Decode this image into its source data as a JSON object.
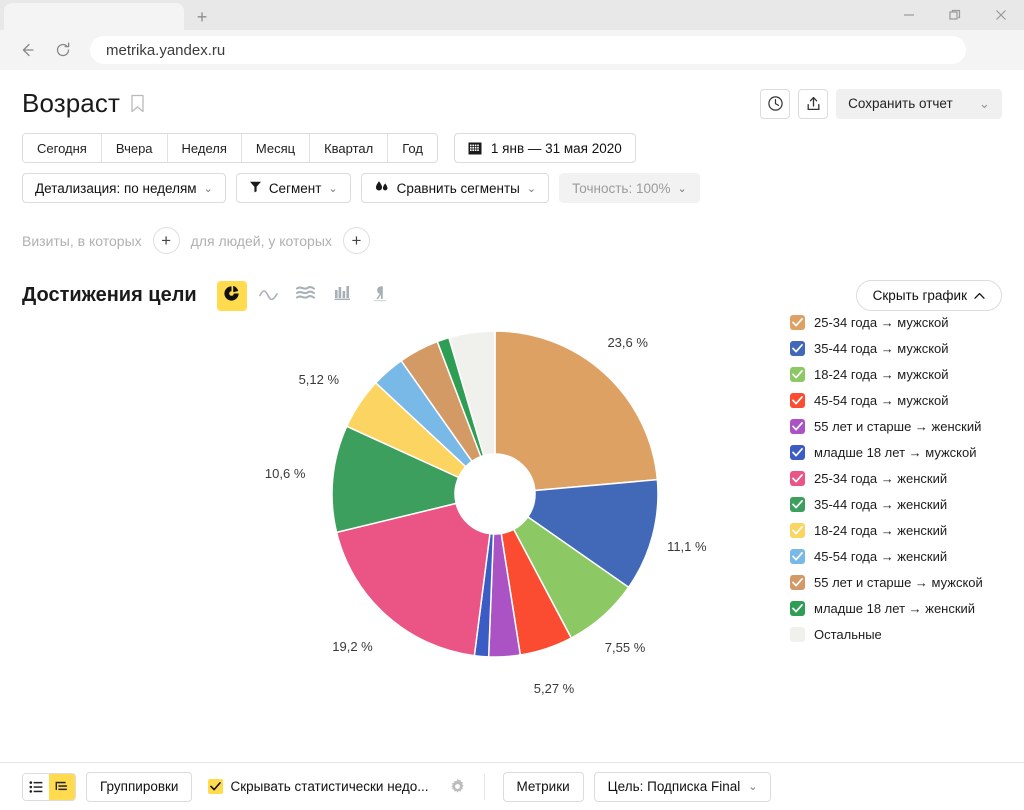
{
  "browser": {
    "tab_title": "",
    "new_tab_label": "+",
    "url": "metrika.yandex.ru",
    "back_icon": "back-arrow-icon",
    "reload_icon": "reload-icon",
    "minimize_icon": "minimize-icon",
    "restore_icon": "restore-icon",
    "close_icon": "close-icon"
  },
  "header": {
    "title": "Возраст",
    "bookmark_icon": "bookmark-icon",
    "history_icon": "clock-icon",
    "export_icon": "share-upload-icon",
    "save_report_label": "Сохранить отчет",
    "save_report_chevron": "⌄"
  },
  "period_tabs": [
    {
      "label": "Сегодня"
    },
    {
      "label": "Вчера"
    },
    {
      "label": "Неделя"
    },
    {
      "label": "Месяц"
    },
    {
      "label": "Квартал"
    },
    {
      "label": "Год"
    }
  ],
  "date_range": {
    "icon": "calendar-icon",
    "value": "1 янв — 31 мая 2020"
  },
  "filter_pills": [
    {
      "name": "detail",
      "label": "Детализация: по неделям",
      "icon": null,
      "chevron": "⌄",
      "disabled": false
    },
    {
      "name": "segment",
      "label": "Сегмент",
      "icon": "funnel-icon",
      "chevron": "⌄",
      "disabled": false
    },
    {
      "name": "compare-segments",
      "label": "Сравнить сегменты",
      "icon": "compare-drops-icon",
      "chevron": "⌄",
      "disabled": false
    },
    {
      "name": "accuracy",
      "label": "Точность: 100%",
      "icon": null,
      "chevron": "⌄",
      "disabled": true
    }
  ],
  "visits_row": {
    "visits_label": "Визиты, в которых",
    "people_label": "для людей, у которых",
    "add_icon": "plus-icon"
  },
  "chart_header": {
    "title": "Достижения цели",
    "hide_chart_label": "Скрыть график",
    "hide_chart_chevron": "⌃",
    "chart_types": [
      {
        "name": "pie-chart-type",
        "icon": "pie-chart-icon",
        "active": true
      },
      {
        "name": "line-chart-type",
        "icon": "line-chart-icon",
        "active": false
      },
      {
        "name": "area-chart-type",
        "icon": "stacked-area-chart-icon",
        "active": false
      },
      {
        "name": "bar-chart-type",
        "icon": "bar-chart-icon",
        "active": false
      },
      {
        "name": "map-chart-type",
        "icon": "map-pin-icon",
        "active": false
      }
    ]
  },
  "chart_data": {
    "type": "pie",
    "title": "Достижения цели",
    "donut": true,
    "legend_position": "right",
    "categories": [
      "25-34 года → мужской",
      "35-44 года → мужской",
      "18-24 года → мужской",
      "45-54 года → мужской",
      "55 лет и старше → женский",
      "младше 18 лет → мужской",
      "25-34 года → женский",
      "35-44 года → женский",
      "18-24 года → женский",
      "45-54 года → женский",
      "55 лет и старше → мужской",
      "младше 18 лет → женский",
      "Остальные"
    ],
    "values": [
      23.6,
      11.1,
      7.55,
      5.27,
      3.1,
      1.4,
      19.2,
      10.6,
      5.12,
      3.3,
      4.0,
      1.2,
      4.56
    ],
    "colors": [
      "#dda263",
      "#4269b8",
      "#8cc863",
      "#fb4c31",
      "#ab53c5",
      "#3b5cc4",
      "#ea5585",
      "#3c9f5e",
      "#fcd462",
      "#79b9e8",
      "#d39a66",
      "#2e9e55",
      "#f0f0ec"
    ],
    "visible_labels": [
      {
        "value": "23,6 %",
        "for": "25-34 года → мужской"
      },
      {
        "value": "11,1 %",
        "for": "35-44 года → мужской"
      },
      {
        "value": "7,55 %",
        "for": "18-24 года → мужской"
      },
      {
        "value": "5,27 %",
        "for": "45-54 года → мужской"
      },
      {
        "value": "19,2 %",
        "for": "25-34 года → женский"
      },
      {
        "value": "10,6 %",
        "for": "35-44 года → женский"
      },
      {
        "value": "5,12 %",
        "for": "18-24 года → женский"
      }
    ]
  },
  "legend": [
    {
      "label": "25-34 года → мужской",
      "color": "#dda263",
      "checked": true
    },
    {
      "label": "35-44 года → мужской",
      "color": "#4269b8",
      "checked": true
    },
    {
      "label": "18-24 года → мужской",
      "color": "#8cc863",
      "checked": true
    },
    {
      "label": "45-54 года → мужской",
      "color": "#fb4c31",
      "checked": true
    },
    {
      "label": "55 лет и старше → женский",
      "color": "#ab53c5",
      "checked": true
    },
    {
      "label": "младше 18 лет → мужской",
      "color": "#3b5cc4",
      "checked": true
    },
    {
      "label": "25-34 года → женский",
      "color": "#ea5585",
      "checked": true
    },
    {
      "label": "35-44 года → женский",
      "color": "#3c9f5e",
      "checked": true
    },
    {
      "label": "18-24 года → женский",
      "color": "#fcd462",
      "checked": true
    },
    {
      "label": "45-54 года → женский",
      "color": "#79b9e8",
      "checked": true
    },
    {
      "label": "55 лет и старше → мужской",
      "color": "#d39a66",
      "checked": true
    },
    {
      "label": "младше 18 лет → женский",
      "color": "#2e9e55",
      "checked": true
    },
    {
      "label": "Остальные",
      "color": "#f0f0ec",
      "checked": false
    }
  ],
  "bottombar": {
    "list_view_icon": "list-view-icon",
    "tree_view_icon": "tree-view-icon",
    "groupings_label": "Группировки",
    "hide_stats_label": "Скрывать статистически недо...",
    "settings_icon": "gear-icon",
    "metrics_label": "Метрики",
    "goal_label": "Цель: Подписка Final",
    "goal_chevron": "⌄"
  }
}
